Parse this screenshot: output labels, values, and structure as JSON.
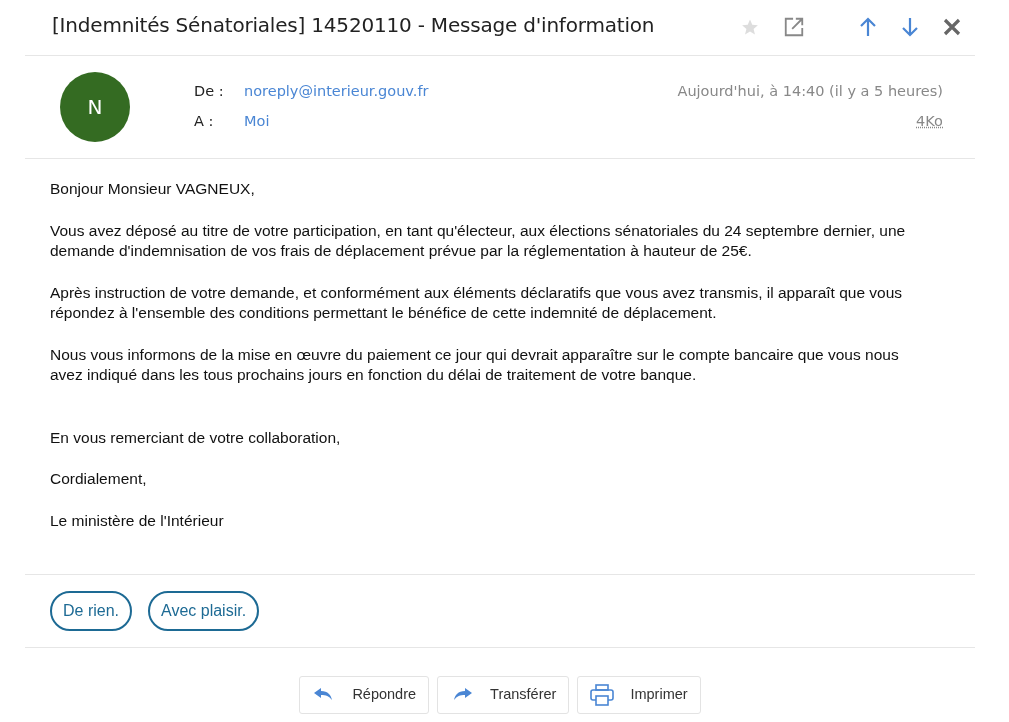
{
  "subject": "[Indemnités Sénatoriales] 14520110 - Message d'information",
  "toolbar": {
    "starred": false
  },
  "sender": {
    "initial": "N",
    "color": "#346b22"
  },
  "from_label": "De :",
  "from": "noreply@interieur.gouv.fr",
  "to_label": "A :",
  "to": "Moi",
  "date": "Aujourd'hui, à 14:40 (il y a 5 heures)",
  "size": "4Ko",
  "body": [
    {
      "text": "Bonjour Monsieur VAGNEUX,"
    },
    {
      "text": "Vous avez déposé au titre de votre participation, en tant qu'électeur, aux élections sénatoriales du 24 septembre dernier, une demande d'indemnisation de vos frais de déplacement prévue par la réglementation à hauteur de 25€."
    },
    {
      "text": "Après instruction de votre demande, et conformément aux éléments déclaratifs que vous avez transmis, il apparaît que vous répondez à l'ensemble des conditions permettant le bénéfice de cette indemnité de déplacement."
    },
    {
      "text": "Nous vous informons de la mise en œuvre du paiement ce jour qui devrait apparaître sur le compte bancaire que vous nous avez indiqué dans les tous prochains jours en fonction du délai de traitement de votre banque."
    },
    {
      "text": "En vous remerciant de votre collaboration,",
      "gap": true
    },
    {
      "text": "Cordialement,"
    },
    {
      "text": "Le ministère de l'Intérieur"
    }
  ],
  "quick_replies": [
    "De rien.",
    "Avec plaisir."
  ],
  "actions": [
    {
      "kind": "reply",
      "label": "Répondre"
    },
    {
      "kind": "forward",
      "label": "Transférer"
    },
    {
      "kind": "print",
      "label": "Imprimer"
    }
  ]
}
